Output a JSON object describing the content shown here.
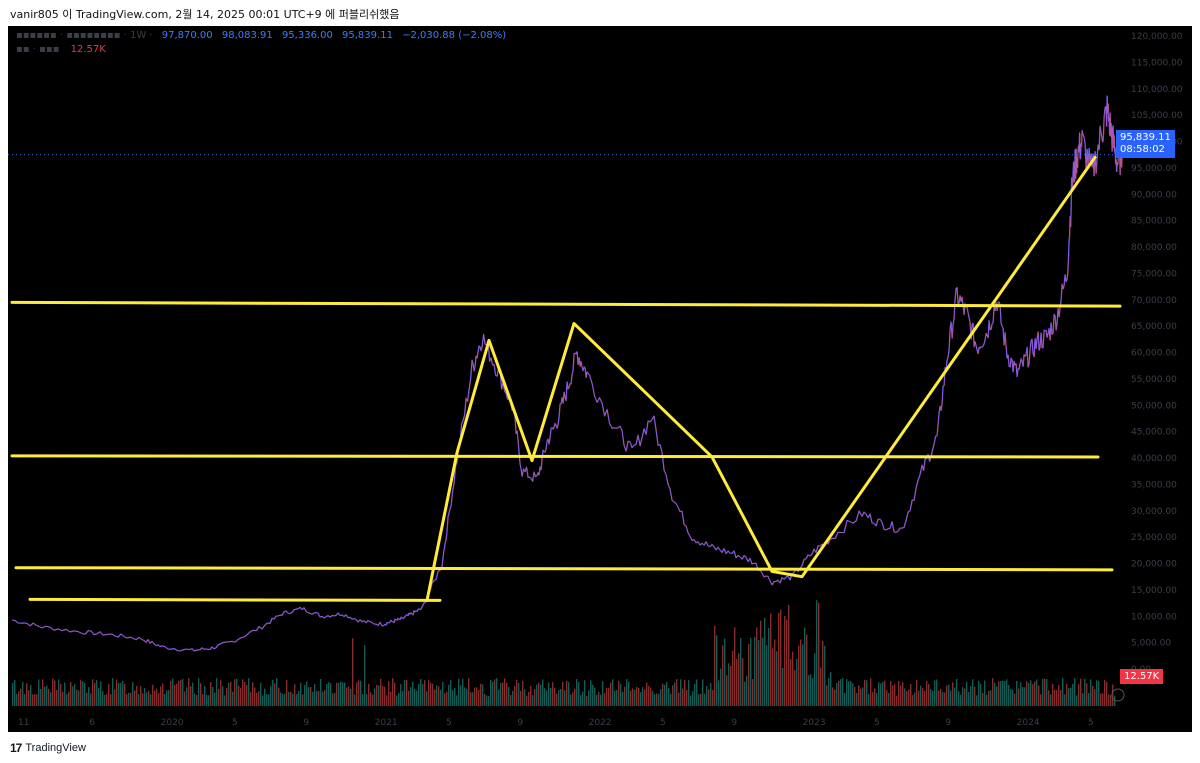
{
  "header": {
    "caption": "vanir805 이 TradingView.com, 2월 14, 2025 00:01 UTC+9 에 퍼블리쉬했음"
  },
  "legend": {
    "open": "97,870.00",
    "high": "98,083.91",
    "low": "95,336.00",
    "close": "95,839.11",
    "change": "−2,030.88 (−2.08%)",
    "volume": "12.57K"
  },
  "price_tag": {
    "price": "95,839.11",
    "countdown": "08:58:02"
  },
  "volume_tag": "12.57K",
  "footer": {
    "brand": "TradingView"
  },
  "colors": {
    "up": "#26a69a",
    "down": "#ef5350",
    "trendline": "#ffeb3b",
    "accent": "#2962ff"
  },
  "chart_data": {
    "type": "line",
    "series": [
      {
        "values": [
          [
            0,
            9300
          ],
          [
            0.03,
            8000
          ],
          [
            0.07,
            7000
          ],
          [
            0.1,
            6500
          ],
          [
            0.13,
            5700
          ],
          [
            0.15,
            4200
          ],
          [
            0.18,
            3500
          ],
          [
            0.2,
            4000
          ],
          [
            0.22,
            5200
          ],
          [
            0.25,
            8000
          ],
          [
            0.27,
            10500
          ],
          [
            0.29,
            11500
          ],
          [
            0.31,
            10000
          ],
          [
            0.33,
            10500
          ],
          [
            0.35,
            9000
          ],
          [
            0.37,
            8500
          ],
          [
            0.38,
            9000
          ],
          [
            0.39,
            9500
          ],
          [
            0.4,
            10500
          ],
          [
            0.41,
            11500
          ],
          [
            0.43,
            20000
          ],
          [
            0.445,
            40000
          ],
          [
            0.46,
            57000
          ],
          [
            0.47,
            63000
          ],
          [
            0.485,
            57000
          ],
          [
            0.5,
            50000
          ],
          [
            0.51,
            37500
          ],
          [
            0.525,
            36000
          ],
          [
            0.535,
            43000
          ],
          [
            0.545,
            47000
          ],
          [
            0.555,
            53000
          ],
          [
            0.565,
            60000
          ],
          [
            0.575,
            56000
          ],
          [
            0.6,
            47000
          ],
          [
            0.62,
            41000
          ],
          [
            0.64,
            48000
          ],
          [
            0.66,
            33000
          ],
          [
            0.68,
            25000
          ],
          [
            0.7,
            23000
          ],
          [
            0.72,
            22000
          ],
          [
            0.74,
            20500
          ],
          [
            0.76,
            16500
          ],
          [
            0.78,
            17500
          ],
          [
            0.8,
            22000
          ],
          [
            0.82,
            25000
          ],
          [
            0.85,
            29500
          ],
          [
            0.87,
            27500
          ],
          [
            0.89,
            26500
          ],
          [
            0.91,
            37500
          ],
          [
            0.925,
            44000
          ],
          [
            0.935,
            59000
          ],
          [
            0.945,
            71000
          ],
          [
            0.955,
            67000
          ],
          [
            0.965,
            61000
          ],
          [
            0.975,
            64000
          ],
          [
            0.985,
            70000
          ],
          [
            0.995,
            60000
          ],
          [
            1.005,
            56000
          ],
          [
            1.015,
            59000
          ],
          [
            1.025,
            62000
          ],
          [
            1.035,
            63000
          ],
          [
            1.045,
            67000
          ],
          [
            1.055,
            75000
          ],
          [
            1.06,
            92000
          ],
          [
            1.065,
            97500
          ],
          [
            1.07,
            100000
          ],
          [
            1.08,
            94000
          ],
          [
            1.09,
            102000
          ],
          [
            1.095,
            106000
          ],
          [
            1.1,
            101000
          ],
          [
            1.105,
            96000
          ],
          [
            1.11,
            97500
          ]
        ]
      }
    ],
    "y_ticks": [
      "120,000.00",
      "115,000.00",
      "110,000.00",
      "105,000.00",
      "100,000.00",
      "95,000.00",
      "90,000.00",
      "85,000.00",
      "80,000.00",
      "75,000.00",
      "70,000.00",
      "65,000.00",
      "60,000.00",
      "55,000.00",
      "50,000.00",
      "45,000.00",
      "40,000.00",
      "35,000.00",
      "30,000.00",
      "25,000.00",
      "20,000.00",
      "15,000.00",
      "10,000.00",
      "5,000.00",
      "0.00"
    ],
    "x_ticks": [
      "11",
      "6",
      "2020",
      "5",
      "9",
      "2021",
      "5",
      "9",
      "2022",
      "5",
      "9",
      "2023",
      "5",
      "9",
      "2024",
      "5"
    ],
    "ylim": [
      0,
      120000
    ],
    "grid": false,
    "legend_position": "top-left",
    "horizontal_levels": [
      {
        "y0": 69500,
        "y1": 68800
      },
      {
        "y0": 40400,
        "y1": 40200
      },
      {
        "y0": 19200,
        "y1": 18800
      },
      {
        "y0": 13200,
        "y1": 13000
      }
    ],
    "trendlines": [
      [
        [
          0.415,
          13000
        ],
        [
          0.445,
          41000
        ],
        [
          0.477,
          62300
        ],
        [
          0.52,
          39500
        ],
        [
          0.562,
          65500
        ],
        [
          0.7,
          40200
        ],
        [
          0.76,
          18500
        ],
        [
          0.79,
          17500
        ],
        [
          1.083,
          97000
        ]
      ]
    ]
  }
}
